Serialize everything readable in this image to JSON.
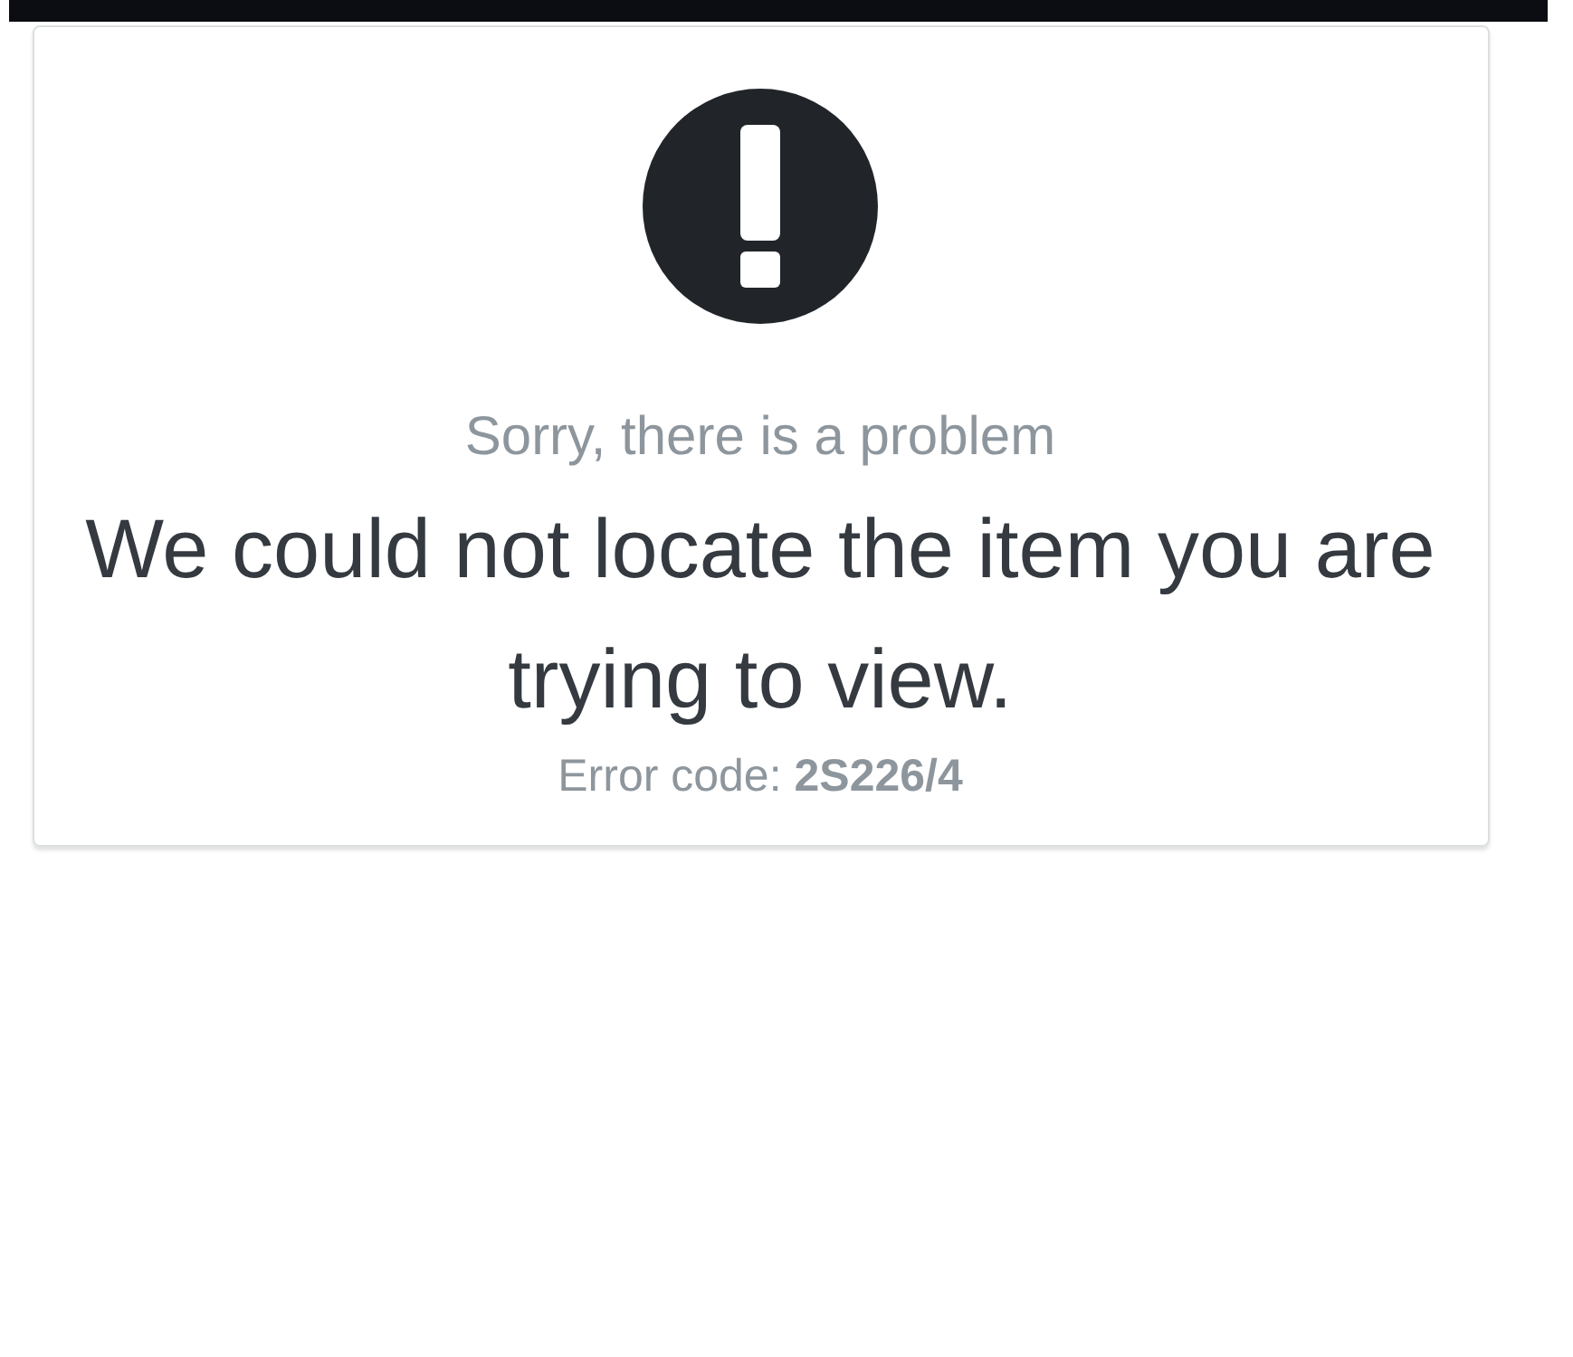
{
  "error_card": {
    "subtitle": "Sorry, there is a problem",
    "message": "We could not locate the item you are trying to view.",
    "error_code": "Error code: **2S226/4**"
  }
}
